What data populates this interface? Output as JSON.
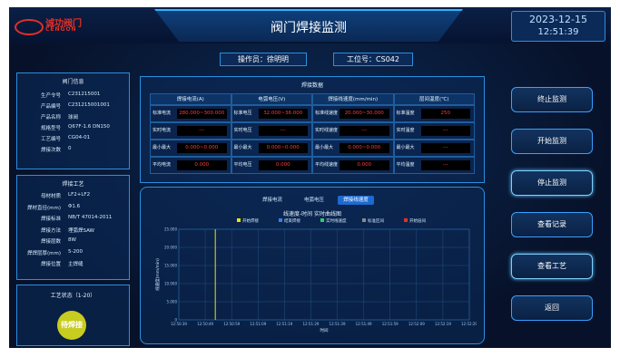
{
  "header": {
    "logo_cn": "诚功阀门",
    "logo_en": "CENGON",
    "title": "阀门焊接监测",
    "date": "2023-12-15",
    "time": "12:51:39",
    "operator": "操作员：徐明明",
    "workstation": "工位号：CS042"
  },
  "product": {
    "title": "阀门信息",
    "rows": [
      {
        "label": "生产令号",
        "value": "C231215001"
      },
      {
        "label": "产品编号",
        "value": "C231215001001"
      },
      {
        "label": "产品名称",
        "value": "球阀"
      },
      {
        "label": "规格型号",
        "value": "Q67F-1.6 DN150"
      },
      {
        "label": "工艺编号",
        "value": "CG04-01"
      },
      {
        "label": "焊接次数",
        "value": "0"
      }
    ]
  },
  "process": {
    "title": "焊接工艺",
    "rows": [
      {
        "label": "母材材质",
        "value": "LF2+LF2"
      },
      {
        "label": "焊材直径(mm)",
        "value": "Φ1.6"
      },
      {
        "label": "焊接标准",
        "value": "NB/T 47014-2011"
      },
      {
        "label": "焊接方法",
        "value": "埋弧焊SAW"
      },
      {
        "label": "焊接层数",
        "value": "8W"
      },
      {
        "label": "焊焊层厚(mm)",
        "value": "5-200"
      },
      {
        "label": "焊接位置",
        "value": "主焊缝"
      }
    ]
  },
  "status": {
    "title": "工艺状态（1-20）",
    "badge": "待焊接"
  },
  "weld_data": {
    "title": "焊接数据",
    "headers": [
      "焊接电流(A)",
      "电弧电压(V)",
      "焊接线速度(mm/min)",
      "层间温度(℃)"
    ],
    "groups": [
      {
        "rows": [
          {
            "label": "标准电流",
            "value": "280.000~300.000"
          },
          {
            "label": "实时电流",
            "value": "---"
          },
          {
            "label": "最小最大",
            "value": "0.000~0.000"
          },
          {
            "label": "平均电流",
            "value": "0.000"
          }
        ]
      },
      {
        "rows": [
          {
            "label": "标准电压",
            "value": "32.000~36.000"
          },
          {
            "label": "实时电压",
            "value": "---"
          },
          {
            "label": "最小最大",
            "value": "0.000~0.000"
          },
          {
            "label": "平均电压",
            "value": "0.000"
          }
        ]
      },
      {
        "rows": [
          {
            "label": "标准线速度",
            "value": "20.000~30.000"
          },
          {
            "label": "实时线速度",
            "value": "---"
          },
          {
            "label": "最小最大",
            "value": "0.000~0.000"
          },
          {
            "label": "平均线速度",
            "value": "0.000"
          }
        ]
      },
      {
        "rows": [
          {
            "label": "标准温度",
            "value": "250"
          },
          {
            "label": "实时温度",
            "value": "---"
          },
          {
            "label": "最小最大",
            "value": "---"
          },
          {
            "label": "平均温度",
            "value": "---"
          }
        ]
      }
    ]
  },
  "chart_tabs": [
    "焊接电流",
    "电弧电压",
    "焊接线速度"
  ],
  "chart_data": {
    "type": "line",
    "title": "线速度-时间 实时曲线图",
    "xlabel": "时间",
    "ylabel": "线速度(mm/min)",
    "legend": [
      "开始焊接",
      "结束焊接",
      "实时线速度",
      "标准区间",
      "开始层间"
    ],
    "legend_colors": [
      "#e6e600",
      "#3a7ef0",
      "#2ecc71",
      "#8a8a8a",
      "#e0302a"
    ],
    "yticks": [
      "25.000",
      "20.000",
      "15.000",
      "10.000",
      "5.000",
      "0"
    ],
    "xticks": [
      "12:50:39",
      "12:50:49",
      "12:50:59",
      "12:51:09",
      "12:51:19",
      "12:51:29",
      "12:51:39",
      "12:51:49",
      "12:51:59",
      "12:52:09",
      "12:52:19",
      "12:52:29"
    ],
    "ylim": [
      0,
      25
    ],
    "marker_start_index": 2
  },
  "buttons": [
    "终止监测",
    "开始监测",
    "停止监测",
    "查看记录",
    "查看工艺",
    "返回"
  ]
}
